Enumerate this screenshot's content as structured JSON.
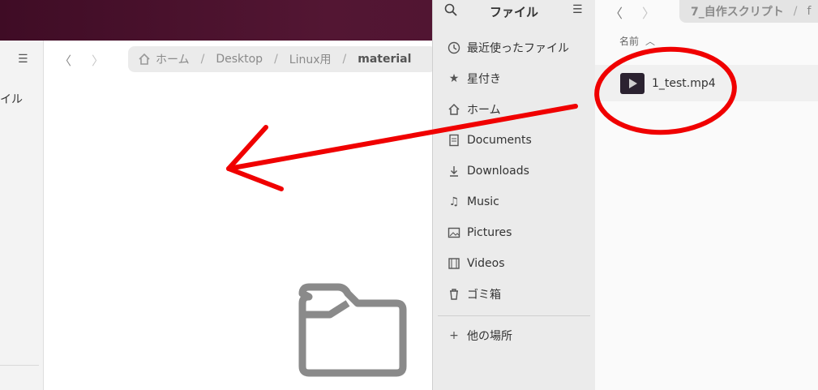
{
  "back_window": {
    "sidebar_text": "イル",
    "path": {
      "home": "ホーム",
      "desktop": "Desktop",
      "linux": "Linux用",
      "current": "material"
    }
  },
  "chooser": {
    "title": "ファイル",
    "sidebar": [
      {
        "label": "最近使ったファイル",
        "icon": "recent-icon"
      },
      {
        "label": "星付き",
        "icon": "star-icon"
      },
      {
        "label": "ホーム",
        "icon": "home-icon"
      },
      {
        "label": "Documents",
        "icon": "document-icon"
      },
      {
        "label": "Downloads",
        "icon": "download-icon"
      },
      {
        "label": "Music",
        "icon": "music-icon"
      },
      {
        "label": "Pictures",
        "icon": "picture-icon"
      },
      {
        "label": "Videos",
        "icon": "video-icon"
      },
      {
        "label": "ゴミ箱",
        "icon": "trash-icon"
      }
    ],
    "other_locations": "他の場所",
    "path": {
      "crumb": "7_自作スクリプト",
      "sep": "/",
      "next": "f"
    },
    "column_name": "名前",
    "file": {
      "name": "1_test.mp4"
    }
  },
  "colors": {
    "annotation": "#f00000",
    "wallpaper": "#531633"
  }
}
